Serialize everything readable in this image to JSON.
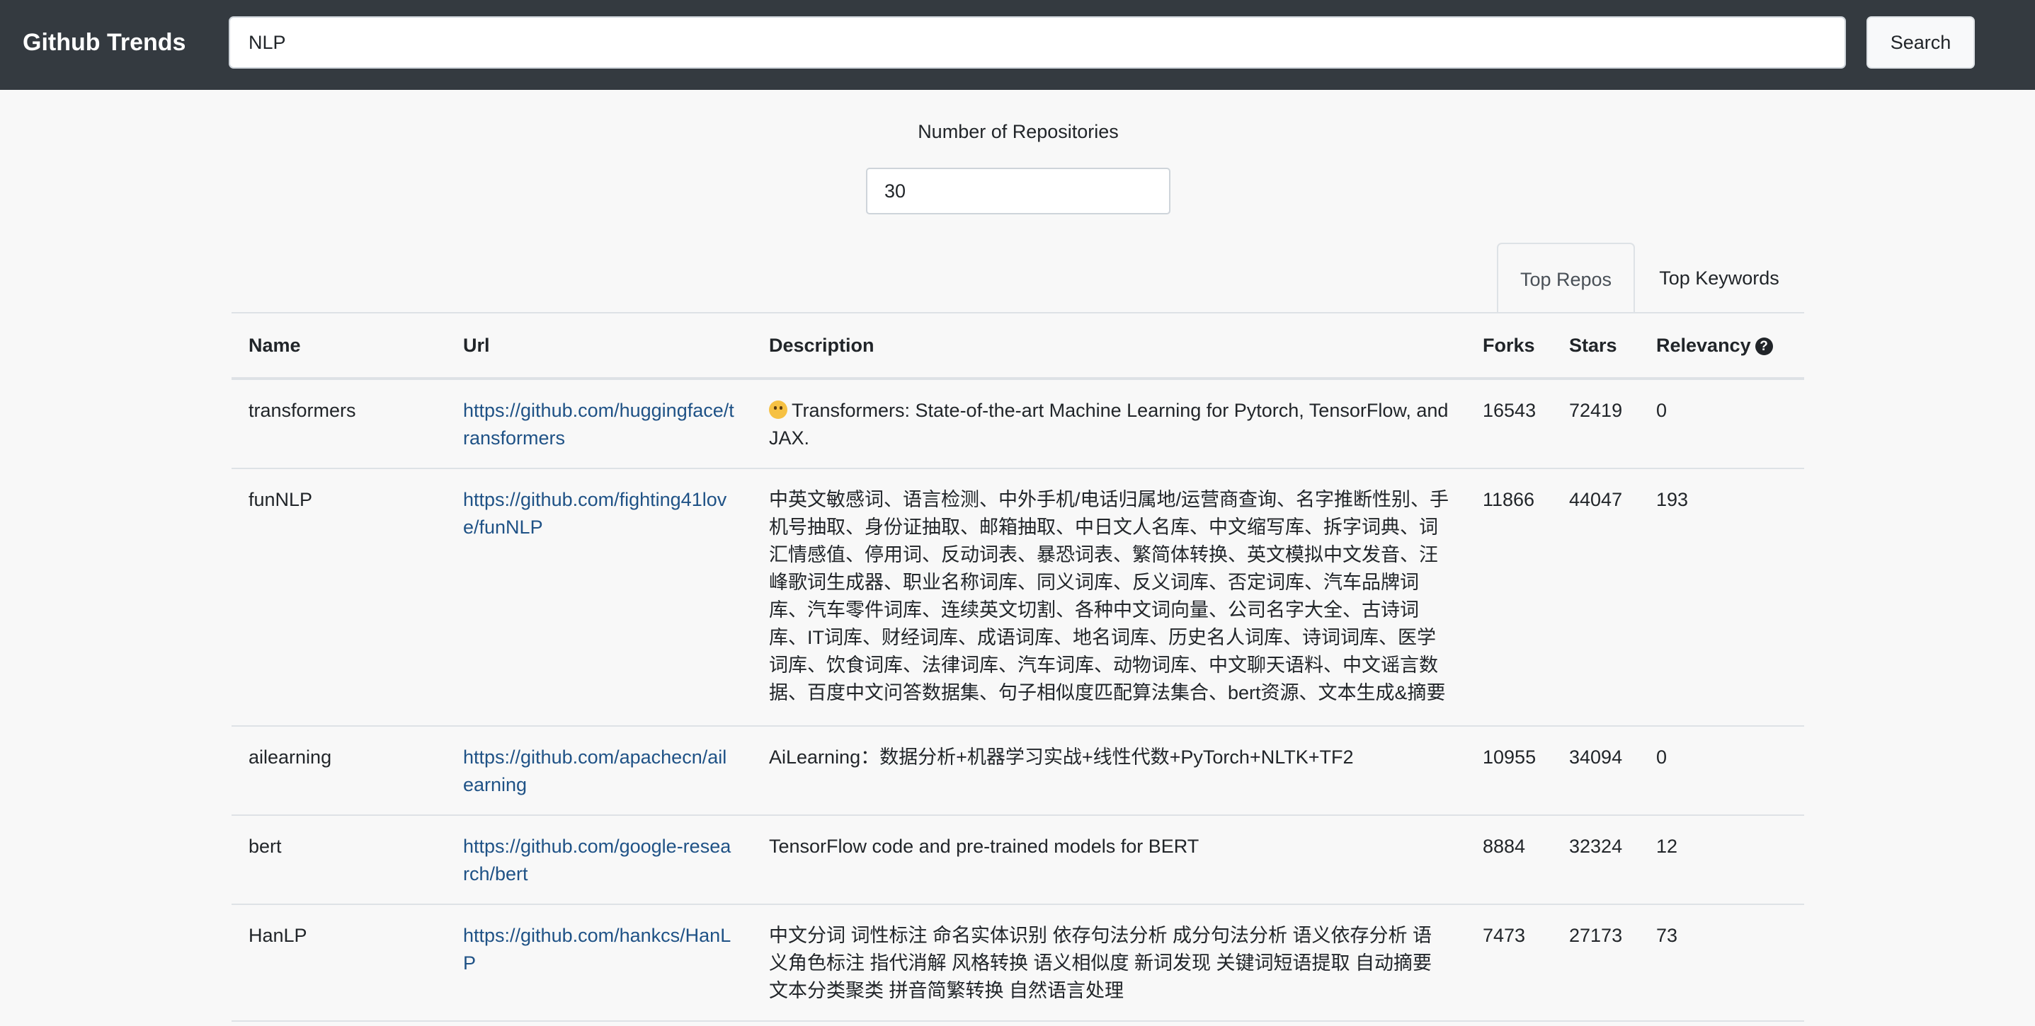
{
  "navbar": {
    "brand": "Github Trends",
    "search_value": "NLP",
    "search_button": "Search"
  },
  "controls": {
    "repo_count_label": "Number of Repositories",
    "repo_count_value": "30"
  },
  "tabs": [
    {
      "label": "Top Repos",
      "active": true
    },
    {
      "label": "Top Keywords",
      "active": false
    }
  ],
  "table": {
    "headers": [
      "Name",
      "Url",
      "Description",
      "Forks",
      "Stars",
      "Relevancy"
    ],
    "rows": [
      {
        "name": "transformers",
        "url": "https://github.com/huggingface/transformers",
        "description": "Transformers: State-of-the-art Machine Learning for Pytorch, TensorFlow, and JAX.",
        "forks": "16543",
        "stars": "72419",
        "relevancy": "0"
      },
      {
        "name": "funNLP",
        "url": "https://github.com/fighting41love/funNLP",
        "description": "中英文敏感词、语言检测、中外手机/电话归属地/运营商查询、名字推断性别、手机号抽取、身份证抽取、邮箱抽取、中日文人名库、中文缩写库、拆字词典、词汇情感值、停用词、反动词表、暴恐词表、繁简体转换、英文模拟中文发音、汪峰歌词生成器、职业名称词库、同义词库、反义词库、否定词库、汽车品牌词库、汽车零件词库、连续英文切割、各种中文词向量、公司名字大全、古诗词库、IT词库、财经词库、成语词库、地名词库、历史名人词库、诗词词库、医学词库、饮食词库、法律词库、汽车词库、动物词库、中文聊天语料、中文谣言数据、百度中文问答数据集、句子相似度匹配算法集合、bert资源、文本生成&摘要相关工具、cocoNLP信息",
        "forks": "11866",
        "stars": "44047",
        "relevancy": "193"
      },
      {
        "name": "ailearning",
        "url": "https://github.com/apachecn/ailearning",
        "description": "AiLearning：数据分析+机器学习实战+线性代数+PyTorch+NLTK+TF2",
        "forks": "10955",
        "stars": "34094",
        "relevancy": "0"
      },
      {
        "name": "bert",
        "url": "https://github.com/google-research/bert",
        "description": "TensorFlow code and pre-trained models for BERT",
        "forks": "8884",
        "stars": "32324",
        "relevancy": "12"
      },
      {
        "name": "HanLP",
        "url": "https://github.com/hankcs/HanLP",
        "description": "中文分词 词性标注 命名实体识别 依存句法分析 成分句法分析 语义依存分析 语义角色标注 指代消解 风格转换 语义相似度 新词发现 关键词短语提取 自动摘要 文本分类聚类 拼音简繁转换 自然语言处理",
        "forks": "7473",
        "stars": "27173",
        "relevancy": "73"
      }
    ]
  },
  "icons": {
    "relevancy_help": "question-circle-icon",
    "transformers_emoji": "hugging-face-emoji-icon"
  },
  "colors": {
    "navbar_bg": "#343a40",
    "link": "#1f5286",
    "page_bg": "#f8f8f8"
  }
}
